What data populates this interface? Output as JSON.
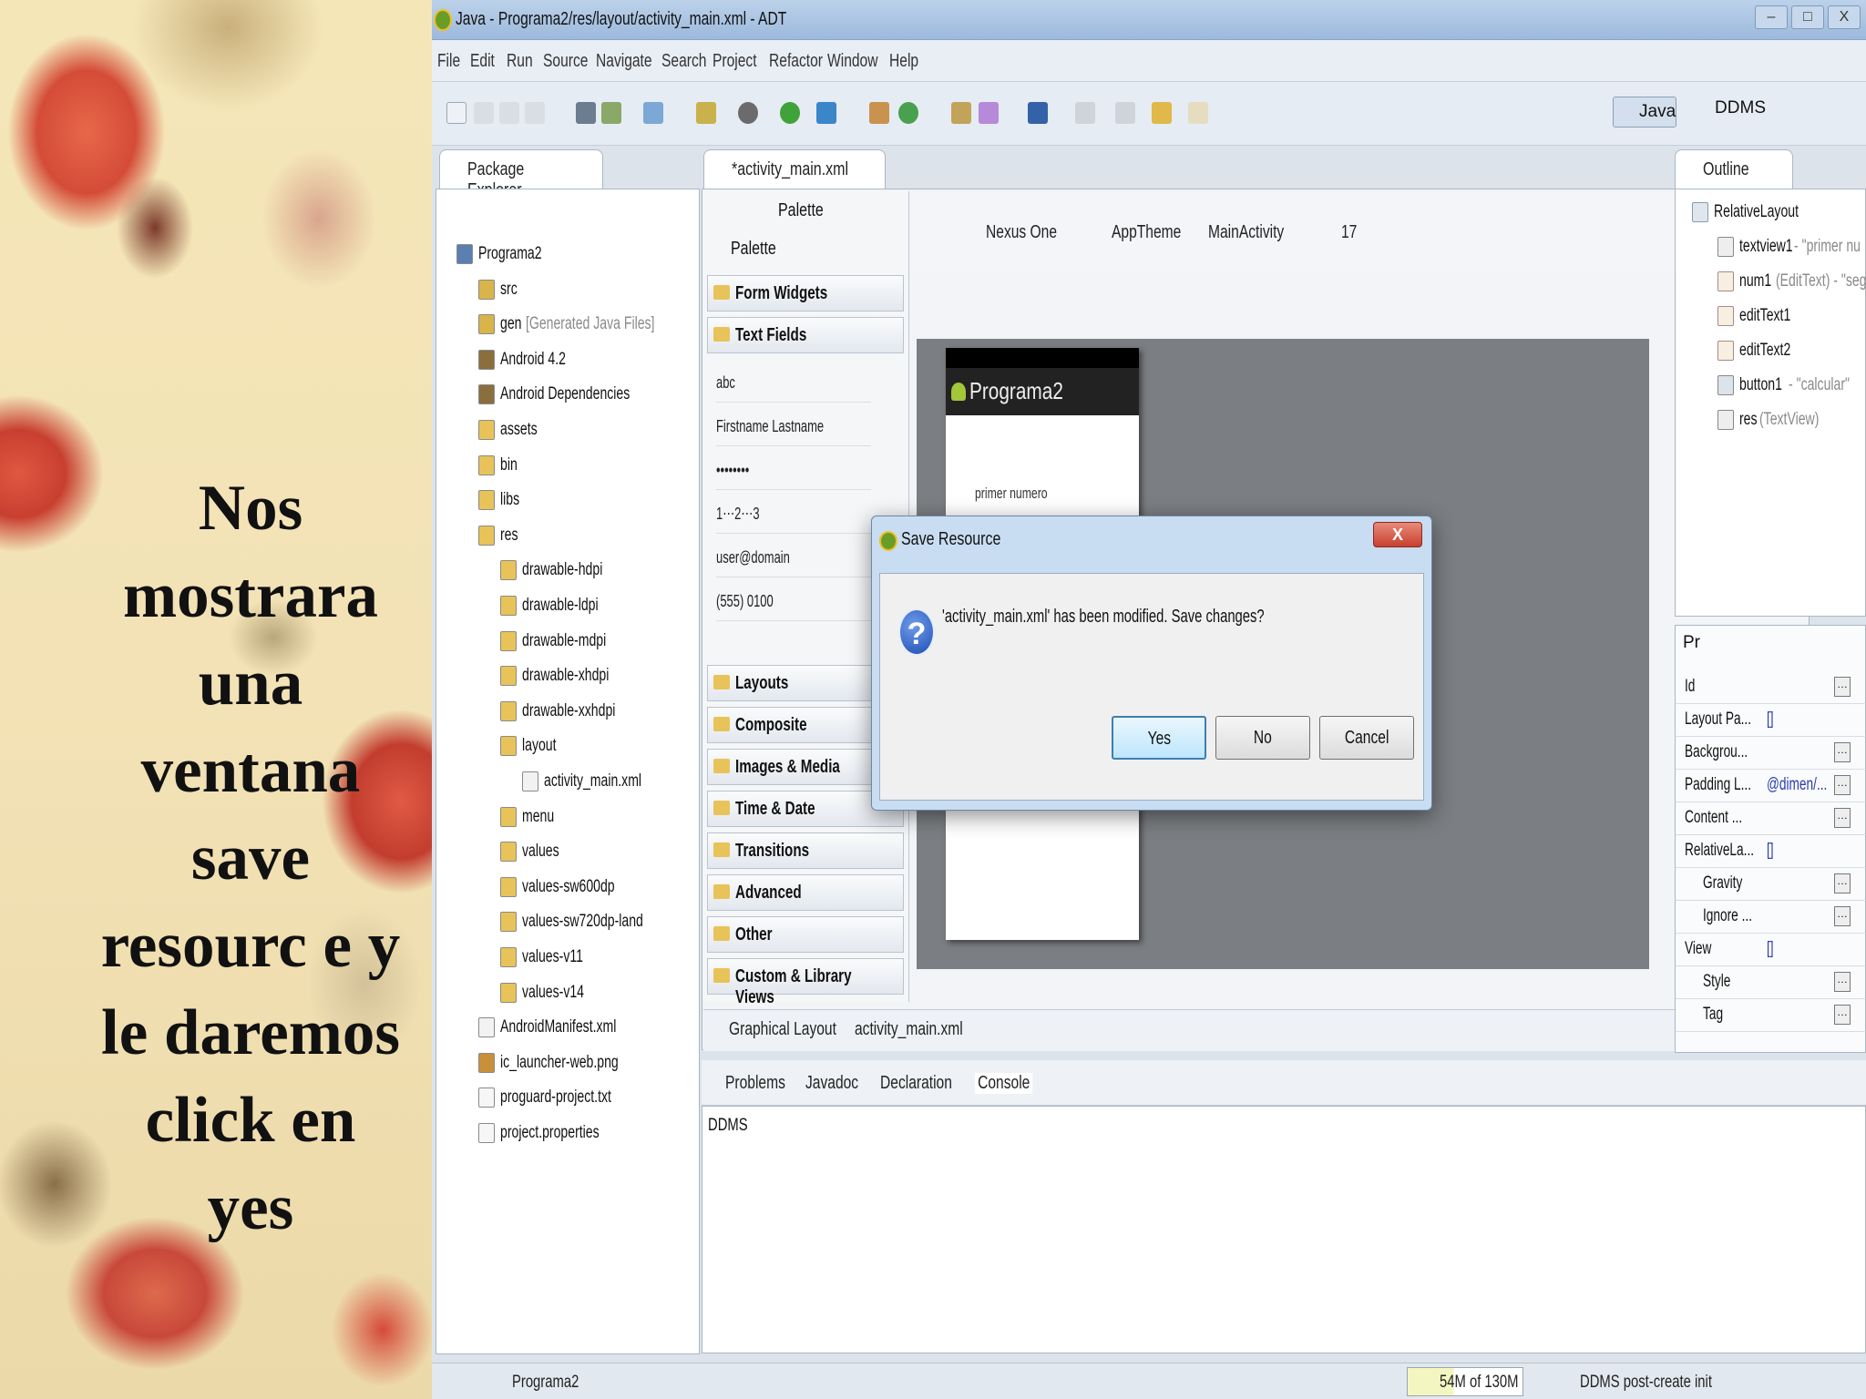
{
  "slide": {
    "lines": [
      "Nos",
      "mostrara",
      "una",
      "ventana",
      "save",
      "resourc e y",
      "le daremos",
      "click en",
      "yes"
    ]
  },
  "window": {
    "title": "Java - Programa2/res/layout/activity_main.xml - ADT",
    "controls": [
      "–",
      "□",
      "X"
    ]
  },
  "menu": [
    "File",
    "Edit",
    "Run",
    "Source",
    "Navigate",
    "Search",
    "Project",
    "Refactor",
    "Window",
    "Help"
  ],
  "perspectives": {
    "java": "Java",
    "ddms": "DDMS"
  },
  "package_explorer": {
    "tab": "Package Explorer",
    "tree": [
      {
        "label": "Programa2",
        "level": 0,
        "icon": "project-icon"
      },
      {
        "label": "src",
        "level": 1,
        "icon": "package-folder-icon"
      },
      {
        "label": "gen",
        "suffix": "[Generated Java Files]",
        "level": 1,
        "icon": "package-folder-icon"
      },
      {
        "label": "Android 4.2",
        "level": 1,
        "icon": "library-icon"
      },
      {
        "label": "Android Dependencies",
        "level": 1,
        "icon": "library-icon"
      },
      {
        "label": "assets",
        "level": 1,
        "icon": "folder-icon"
      },
      {
        "label": "bin",
        "level": 1,
        "icon": "folder-icon"
      },
      {
        "label": "libs",
        "level": 1,
        "icon": "folder-icon"
      },
      {
        "label": "res",
        "level": 1,
        "icon": "folder-icon"
      },
      {
        "label": "drawable-hdpi",
        "level": 2,
        "icon": "folder-icon"
      },
      {
        "label": "drawable-ldpi",
        "level": 2,
        "icon": "folder-icon"
      },
      {
        "label": "drawable-mdpi",
        "level": 2,
        "icon": "folder-icon"
      },
      {
        "label": "drawable-xhdpi",
        "level": 2,
        "icon": "folder-icon"
      },
      {
        "label": "drawable-xxhdpi",
        "level": 2,
        "icon": "folder-icon"
      },
      {
        "label": "layout",
        "level": 2,
        "icon": "folder-icon"
      },
      {
        "label": "activity_main.xml",
        "level": 3,
        "icon": "xml-file-icon"
      },
      {
        "label": "menu",
        "level": 2,
        "icon": "folder-icon"
      },
      {
        "label": "values",
        "level": 2,
        "icon": "folder-icon"
      },
      {
        "label": "values-sw600dp",
        "level": 2,
        "icon": "folder-icon"
      },
      {
        "label": "values-sw720dp-land",
        "level": 2,
        "icon": "folder-icon"
      },
      {
        "label": "values-v11",
        "level": 2,
        "icon": "folder-icon"
      },
      {
        "label": "values-v14",
        "level": 2,
        "icon": "folder-icon"
      },
      {
        "label": "AndroidManifest.xml",
        "level": 1,
        "icon": "xml-file-icon"
      },
      {
        "label": "ic_launcher-web.png",
        "level": 1,
        "icon": "image-file-icon"
      },
      {
        "label": "proguard-project.txt",
        "level": 1,
        "icon": "text-file-icon"
      },
      {
        "label": "project.properties",
        "level": 1,
        "icon": "text-file-icon"
      }
    ]
  },
  "editor": {
    "tab": "*activity_main.xml",
    "palette_header": "Palette",
    "palette_dropdown": "Palette",
    "categories": [
      "Form Widgets",
      "Text Fields",
      "Layouts",
      "Composite",
      "Images & Media",
      "Time & Date",
      "Transitions",
      "Advanced",
      "Other",
      "Custom & Library Views"
    ],
    "text_fields": [
      "abc",
      "Firstname Lastname",
      "••••••••",
      "1⋯2⋯3",
      "user@domain",
      "(555) 0100"
    ],
    "device": "Nexus One",
    "theme": "AppTheme",
    "activity": "MainActivity",
    "api": "17",
    "app_name": "Programa2",
    "preview_label": "primer numero",
    "bottom_tabs": [
      "Graphical Layout",
      "activity_main.xml"
    ]
  },
  "outline": {
    "tab": "Outline",
    "root": "RelativeLayout",
    "items": [
      {
        "id": "textview1",
        "detail": "- \"primer nu"
      },
      {
        "id": "num1",
        "detail": "(EditText) - \"seg"
      },
      {
        "id": "editText1",
        "detail": ""
      },
      {
        "id": "editText2",
        "detail": ""
      },
      {
        "id": "button1",
        "detail": "- \"calcular\""
      },
      {
        "id": "res",
        "detail": "(TextView)"
      }
    ]
  },
  "properties": {
    "tab": "Pr",
    "rows": [
      {
        "key": "Id",
        "value": ""
      },
      {
        "key": "Layout Pa...",
        "value": "[]"
      },
      {
        "key": "Backgrou...",
        "value": ""
      },
      {
        "key": "Padding L...",
        "value": "@dimen/..."
      },
      {
        "key": "Content ...",
        "value": ""
      },
      {
        "key": "RelativeLa...",
        "value": "[]"
      },
      {
        "key": "Gravity",
        "value": ""
      },
      {
        "key": "Ignore ...",
        "value": ""
      },
      {
        "key": "View",
        "value": "[]"
      },
      {
        "key": "Style",
        "value": ""
      },
      {
        "key": "Tag",
        "value": ""
      }
    ]
  },
  "console": {
    "tabs": [
      "Problems",
      "Javadoc",
      "Declaration",
      "Console"
    ],
    "content": "DDMS"
  },
  "status": {
    "project": "Programa2",
    "memory": "54M of 130M",
    "task": "DDMS post-create init"
  },
  "dialog": {
    "title": "Save Resource",
    "close": "X",
    "message": "'activity_main.xml' has been modified. Save changes?",
    "buttons": {
      "yes": "Yes",
      "no": "No",
      "cancel": "Cancel"
    }
  },
  "colors": {
    "java_green": "#6a9d28",
    "dialog_frame": "#c9ddf2",
    "close_red": "#c8402e",
    "question_blue": "#1d4fb5"
  }
}
